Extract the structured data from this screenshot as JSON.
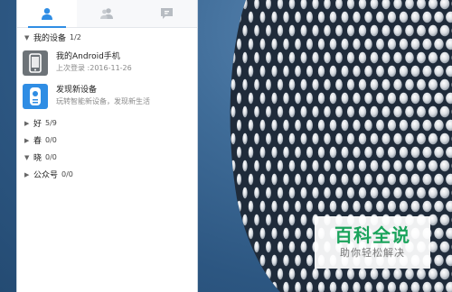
{
  "tabs": [
    {
      "name": "contacts",
      "icon": "user-icon",
      "active": true
    },
    {
      "name": "groups",
      "icon": "group-icon",
      "active": false
    },
    {
      "name": "messages",
      "icon": "message-icon",
      "active": false
    }
  ],
  "devices_group": {
    "label": "我的设备",
    "count": "1/2"
  },
  "devices": [
    {
      "title": "我的Android手机",
      "subtitle": "上次登录 :2016-11-26",
      "icon": "phone-icon",
      "color": "#6d7378"
    },
    {
      "title": "发现新设备",
      "subtitle": "玩转智能新设备，发现新生活",
      "icon": "device-discover-icon",
      "color": "#2f8de4"
    }
  ],
  "groups": [
    {
      "label": "好",
      "count": "5/9",
      "expanded": false
    },
    {
      "label": "春",
      "count": "0/0",
      "expanded": false
    },
    {
      "label": "晓",
      "count": "0/0",
      "expanded": true
    },
    {
      "label": "公众号",
      "count": "0/0",
      "expanded": false
    }
  ],
  "watermark": {
    "title": "百科全说",
    "subtitle": "助你轻松解决"
  },
  "colors": {
    "accent": "#2f8de4",
    "brand_green": "#1aa35b"
  }
}
